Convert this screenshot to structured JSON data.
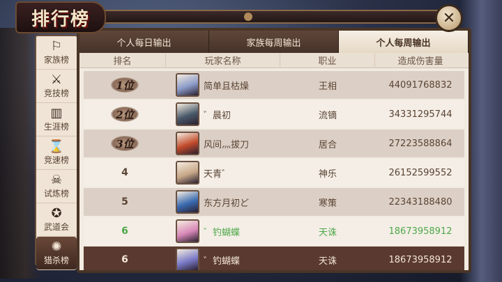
{
  "title": "排行榜",
  "close_icon_text": "✕",
  "tabs": [
    {
      "label": "个人每日输出",
      "active": false
    },
    {
      "label": "家族每周输出",
      "active": false
    },
    {
      "label": "个人每周输出",
      "active": true
    }
  ],
  "columns": {
    "rank": "排名",
    "player": "玩家名称",
    "job": "职业",
    "damage": "造成伤害量"
  },
  "sidebar": [
    {
      "label": "家族榜",
      "icon": "family-icon",
      "glyph": "⚐"
    },
    {
      "label": "竞技榜",
      "icon": "crossed-swords-icon",
      "glyph": "⚔"
    },
    {
      "label": "生涯榜",
      "icon": "book-icon",
      "glyph": "▥"
    },
    {
      "label": "竞速榜",
      "icon": "hourglass-icon",
      "glyph": "⌛"
    },
    {
      "label": "试炼榜",
      "icon": "demon-mask-icon",
      "glyph": "☠"
    },
    {
      "label": "武道会",
      "icon": "martial-arts-icon",
      "glyph": "✪"
    },
    {
      "label": "猎杀榜",
      "icon": "hunt-icon",
      "glyph": "✺",
      "active": true
    }
  ],
  "rows": [
    {
      "rank": "1位",
      "name": "简单且枯燥",
      "job": "王相",
      "damage": "44091768832",
      "style": "shade",
      "avatar_color": "#8a9ac8"
    },
    {
      "rank": "2位",
      "name": "゛晨初",
      "job": "流镝",
      "damage": "34331295744",
      "style": "plain",
      "avatar_color": "#4a5a6a"
    },
    {
      "rank": "3位",
      "name": "风间灬拔刀",
      "job": "居合",
      "damage": "27223588864",
      "style": "shade",
      "avatar_color": "#c24a2a"
    },
    {
      "rank": "4",
      "name": "天青゛",
      "job": "神乐",
      "damage": "26152599552",
      "style": "plain",
      "avatar_color": "#c8a888"
    },
    {
      "rank": "5",
      "name": "东方月初ど",
      "job": "寒策",
      "damage": "22343188480",
      "style": "shade",
      "avatar_color": "#3a6ab0"
    },
    {
      "rank": "6",
      "name": "゛钓蝴蝶",
      "job": "天诛",
      "damage": "18673958912",
      "style": "plain self",
      "avatar_color": "#d888b8"
    },
    {
      "rank": "6",
      "name": "゛钓蝴蝶",
      "job": "天诛",
      "damage": "18673958912",
      "style": "selected",
      "avatar_color": "#7a7ac8"
    }
  ]
}
